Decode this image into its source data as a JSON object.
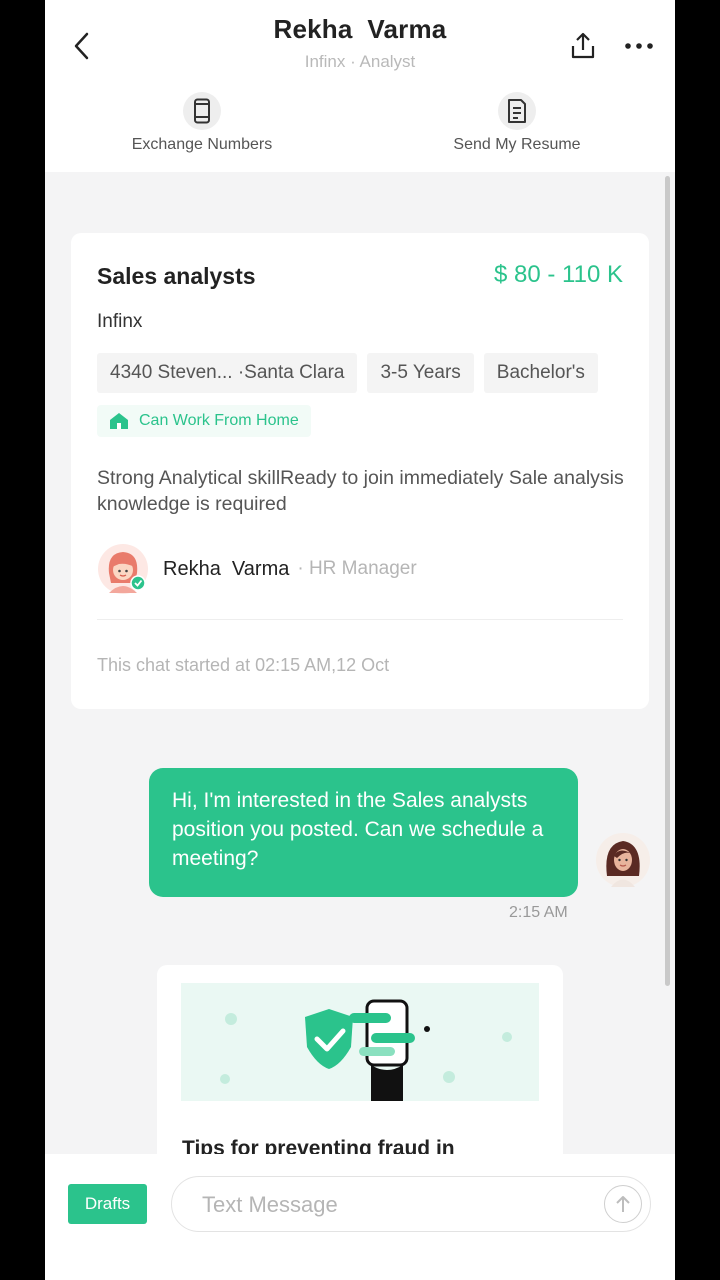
{
  "header": {
    "title": "Rekha  Varma",
    "subtitle": "Infinx · Analyst",
    "actions": [
      {
        "label": "Exchange Numbers",
        "icon": "phone-icon"
      },
      {
        "label": "Send My Resume",
        "icon": "resume-icon"
      }
    ]
  },
  "job_card": {
    "title": "Sales analysts",
    "salary": "$ 80 - 110 K",
    "company": "Infinx",
    "tags": [
      "4340 Steven... ·Santa Clara",
      "3-5 Years",
      "Bachelor's"
    ],
    "work_from_home": "Can Work From Home",
    "description": "Strong Analytical skillReady to join immediately Sale analysis knowledge is required",
    "recruiter_name": "Rekha  Varma",
    "recruiter_role": "· HR Manager",
    "chat_started": "This chat started at 02:15 AM,12 Oct"
  },
  "message": {
    "text": "Hi, I'm interested in the Sales analysts  position you posted. Can we schedule a meeting?",
    "time": "2:15 AM"
  },
  "tips": {
    "title": "Tips for preventing fraud in"
  },
  "composer": {
    "drafts_label": "Drafts",
    "placeholder": "Text Message"
  },
  "colors": {
    "accent": "#2bc38c",
    "background": "#f4f4f5"
  }
}
